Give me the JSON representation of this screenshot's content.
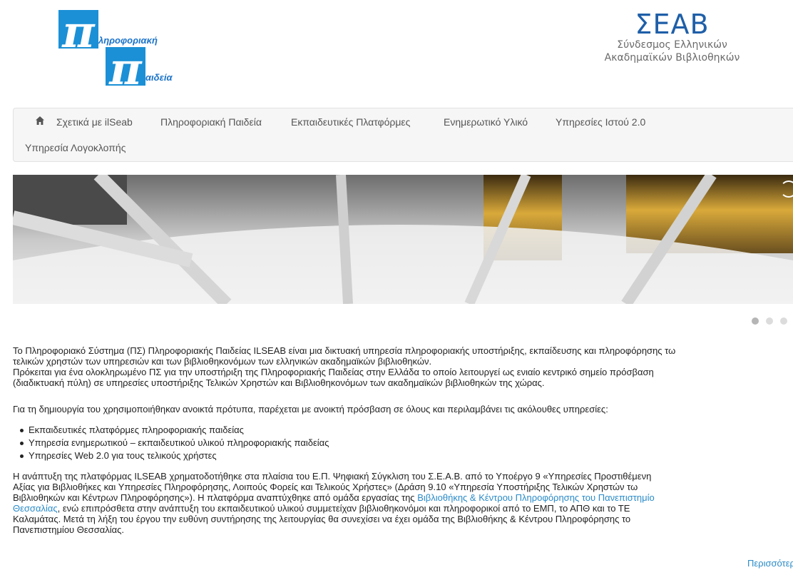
{
  "logos": {
    "left": {
      "letter_top": "π",
      "word_top": "ληροφοριακή",
      "letter_bottom": "π",
      "word_bottom": "αιδεία"
    },
    "right": {
      "title": "ΣΕΑΒ",
      "subtitle_line1": "Σύνδεσμος Ελληνικών",
      "subtitle_line2": "Ακαδημαϊκών Βιβλιοθηκών"
    }
  },
  "nav": {
    "home_icon": "home-icon",
    "items": [
      "Σχετικά με ilSeab",
      "Πληροφοριακή Παιδεία",
      "Εκπαιδευτικές Πλατφόρμες",
      "Ενημερωτικό Υλικό",
      "Υπηρεσίες Ιστού 2.0",
      "Υπηρεσία Λογοκλοπής"
    ]
  },
  "slider": {
    "icon": "spinner-icon",
    "active_index": 0,
    "count": 3
  },
  "content": {
    "intro_lines": [
      "Το Πληροφοριακό Σύστημα (ΠΣ) Πληροφοριακής Παιδείας ILSEAB είναι μια δικτυακή υπηρεσία πληροφοριακής υποστήριξης, εκπαίδευσης και πληροφόρησης τω",
      "τελικών χρηστών των υπηρεσιών και των βιβλιοθηκονόμων των ελληνικών ακαδημαϊκών βιβλιοθηκών.",
      "Πρόκειται για ένα ολοκληρωμένο ΠΣ για την υποστήριξη της Πληροφοριακής Παιδείας στην Ελλάδα το οποίο λειτουργεί ως ενιαίο κεντρικό σημείο πρόσβαση",
      "(διαδικτυακή πύλη) σε υπηρεσίες υποστήριξης Τελικών Χρηστών και Βιβλιοθηκονόμων των ακαδημαϊκών βιβλιοθηκών της χώρας."
    ],
    "standards": "Για τη δημιουργία του χρησιμοποιήθηκαν ανοικτά πρότυπα, παρέχεται με ανοικτή πρόσβαση σε όλους και περιλαμβάνει τις ακόλουθες υπηρεσίες:",
    "services": [
      "Εκπαιδευτικές πλατφόρμες πληροφοριακής παιδείας",
      "Υπηρεσία ενημερωτικού – εκπαιδευτικού υλικού πληροφοριακής παιδείας",
      "Υπηρεσίες Web 2.0 για τους τελικούς χρήστες"
    ],
    "funding": {
      "line1": "Η ανάπτυξη της πλατφόρμας ILSEAB χρηματοδοτήθηκε στα πλαίσια του Ε.Π. Ψηφιακή Σύγκλιση του Σ.Ε.Α.Β. από το Υποέργο 9 «Υπηρεσίες Προστιθέμενη",
      "line2": "Αξίας για Βιβλιοθήκες και Υπηρεσίες Πληροφόρησης, Λοιπούς Φορείς και Τελικούς Χρήστες» (Δράση 9.10 «Υπηρεσία Υποστήριξης Τελικών Χρηστών τω",
      "line3_text": "Βιβλιοθηκών και Κέντρων Πληροφόρησης»). Η πλατφόρμα αναπτύχθηκε από ομάδα εργασίας της ",
      "line3_link": "Βιβλιοθήκης & Κέντρου Πληροφόρησης του Πανεπιστημίο",
      "line4_link": "Θεσσαλίας",
      "line4_text": ", ενώ επιπρόσθετα στην ανάπτυξη του εκπαιδευτικού υλικού συμμετείχαν βιβλιοθηκονόμοι και πληροφορικοί από το ΕΜΠ, το ΑΠΘ και το ΤΕ",
      "line5": "Καλαμάτας. Μετά τη λήξη του έργου την ευθύνη συντήρησης της λειτουργίας θα συνεχίσει να έχει ομάδα της Βιβλιοθήκης & Κέντρου Πληροφόρησης το",
      "line6": "Πανεπιστημίου Θεσσαλίας."
    },
    "more_link": "Περισσότερα..."
  },
  "colors": {
    "brand_blue": "#1b90d6",
    "seab_blue": "#1f5fa8",
    "link": "#2a8bc8",
    "nav_bg": "#f6f6f6"
  }
}
